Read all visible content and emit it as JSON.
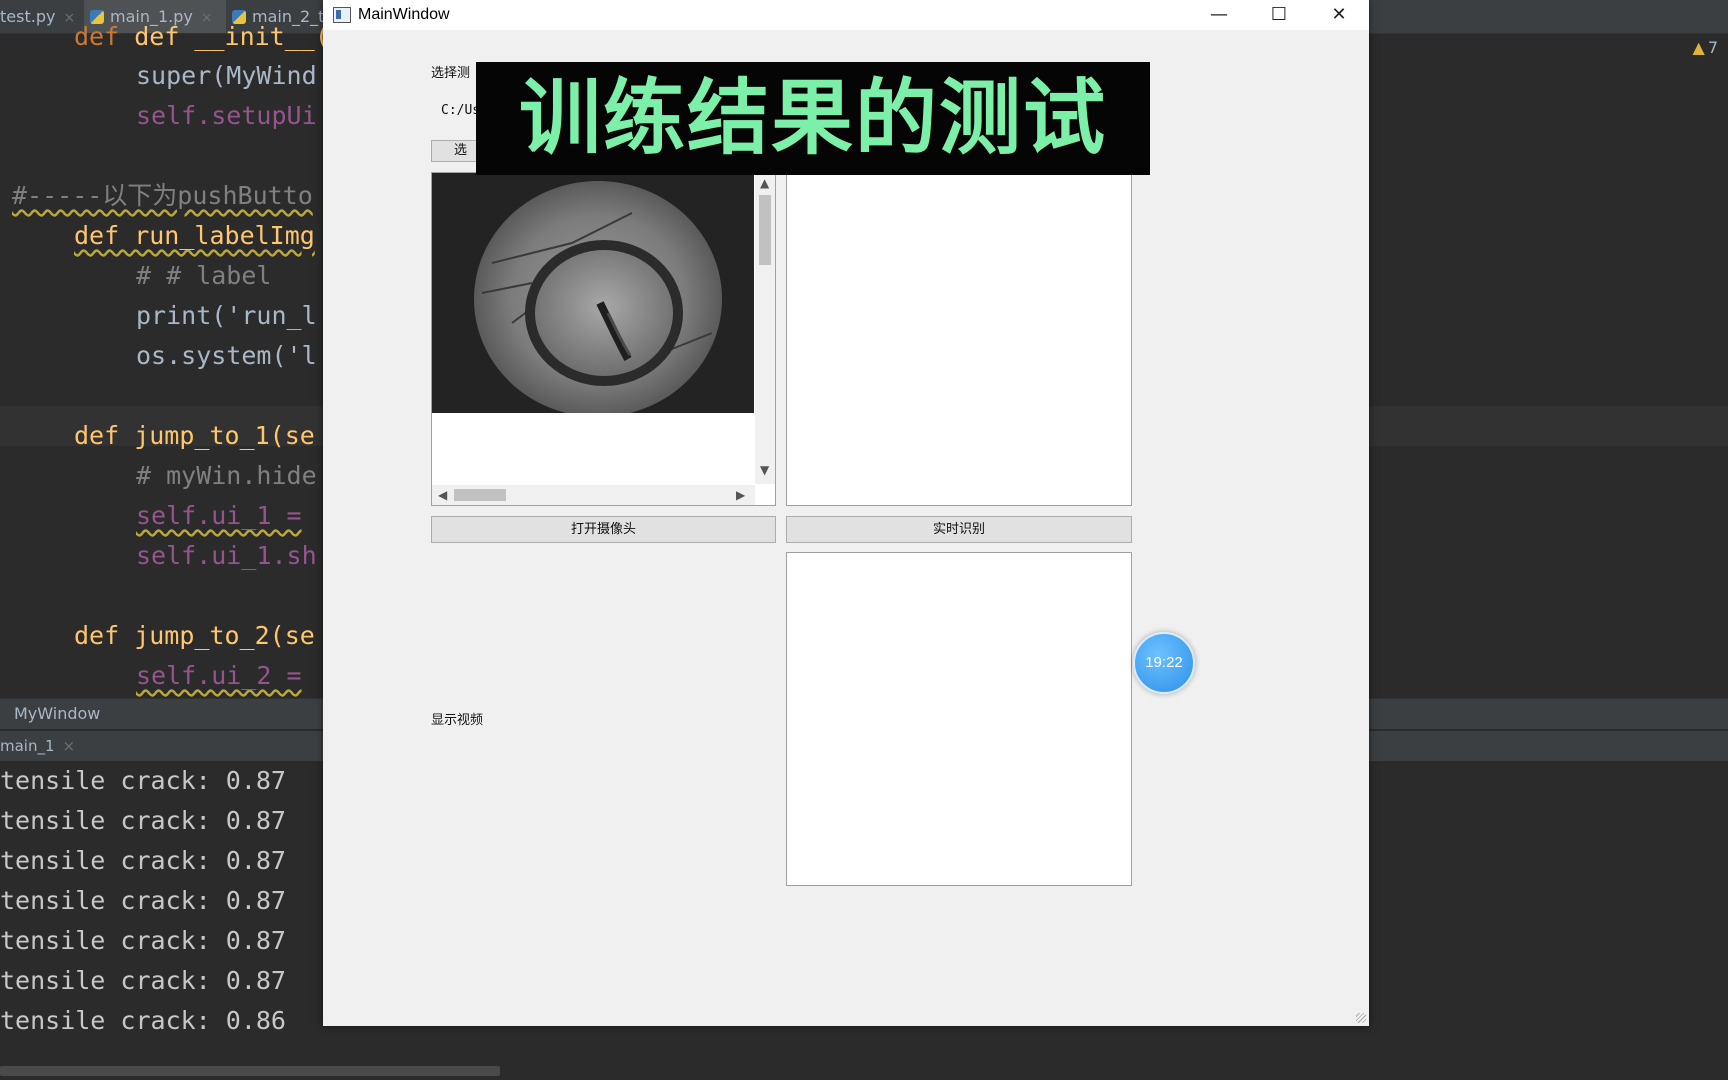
{
  "ide": {
    "tabs": [
      {
        "label": "test.py"
      },
      {
        "label": "main_1.py"
      },
      {
        "label": "main_2_t"
      }
    ],
    "code_lines": [
      {
        "t": "def __init__(sel"
      },
      {
        "t": "super(MyWind"
      },
      {
        "t": "self.setupUi"
      },
      {
        "t": "#-----以下为pushButto"
      },
      {
        "t": "def run_labelImg"
      },
      {
        "t": "# # label"
      },
      {
        "t": "print('run_l"
      },
      {
        "t": "os.system('l"
      },
      {
        "t": "def jump_to_1(se"
      },
      {
        "t": "# myWin.hide"
      },
      {
        "t": "self.ui_1 ="
      },
      {
        "t": "self.ui_1.sh"
      },
      {
        "t": "def jump_to_2(se"
      },
      {
        "t": "self.ui_2 ="
      }
    ],
    "warning_count": "7",
    "breadcrumb": "MyWindow",
    "run_tab": "main_1",
    "console_lines": [
      "tensile crack: 0.87",
      "tensile crack: 0.87",
      "tensile crack: 0.87",
      "tensile crack: 0.87",
      "tensile crack: 0.87",
      "tensile crack: 0.87",
      "tensile crack: 0.86"
    ]
  },
  "window": {
    "title": "MainWindow",
    "controls": {
      "minimize": "—",
      "maximize": "☐",
      "close": "✕"
    },
    "select_label": "选择测",
    "path_text": "C:/Us",
    "select_button": "选",
    "open_camera_button": "打开摄像头",
    "realtime_button": "实时识别",
    "video_label": "显示视频"
  },
  "overlay_caption": "训练结果的测试",
  "timer_badge": "19:22"
}
